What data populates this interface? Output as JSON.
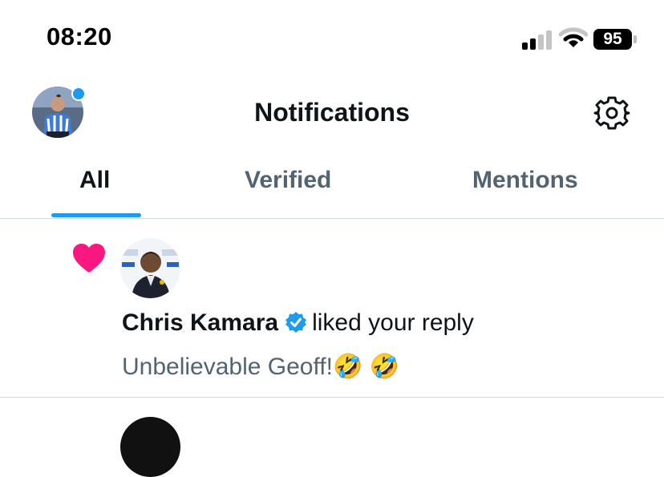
{
  "status_bar": {
    "time": "08:20",
    "battery": "95"
  },
  "header": {
    "title": "Notifications",
    "icons": {
      "settings": "gear-icon",
      "profile": "avatar"
    }
  },
  "tabs": [
    {
      "label": "All",
      "active": true
    },
    {
      "label": "Verified",
      "active": false
    },
    {
      "label": "Mentions",
      "active": false
    }
  ],
  "notifications": [
    {
      "icon": "heart-icon",
      "user": "Chris Kamara",
      "verified": true,
      "action": "liked your reply",
      "text": "Unbelievable Geoff!🤣 🤣"
    }
  ],
  "colors": {
    "accent": "#1d9bf0",
    "heart": "#f91880",
    "text_primary": "#0f1419",
    "text_secondary": "#536471",
    "divider": "#cfd9de"
  }
}
